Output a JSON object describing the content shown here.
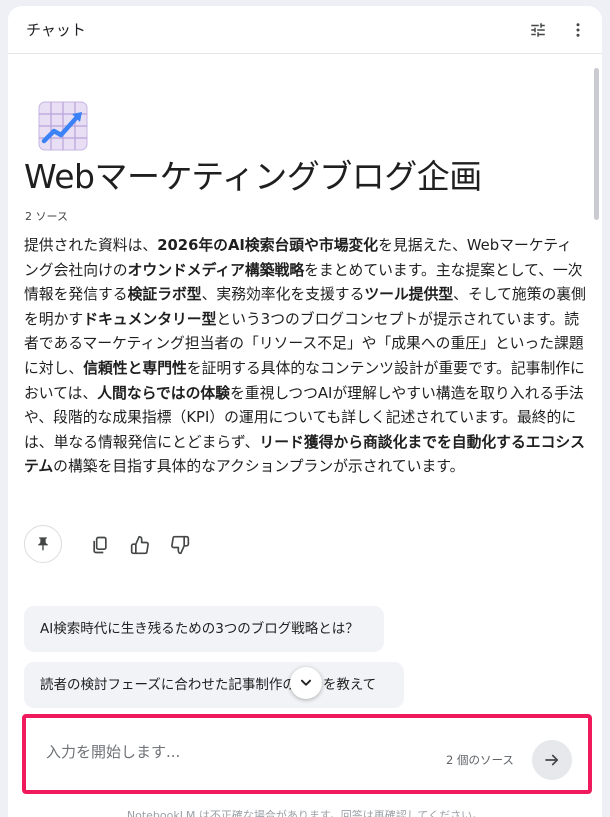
{
  "header": {
    "title": "チャット"
  },
  "notebook": {
    "title": "Webマーケティングブログ企画",
    "sources_label": "2 ソース",
    "summary": [
      {
        "text": "提供された資料は、",
        "bold": false
      },
      {
        "text": "2026年のAI検索台頭や市場変化",
        "bold": true
      },
      {
        "text": "を見据えた、Webマーケティング会社向けの",
        "bold": false
      },
      {
        "text": "オウンドメディア構築戦略",
        "bold": true
      },
      {
        "text": "をまとめています。主な提案として、一次情報を発信する",
        "bold": false
      },
      {
        "text": "検証ラボ型",
        "bold": true
      },
      {
        "text": "、実務効率化を支援する",
        "bold": false
      },
      {
        "text": "ツール提供型",
        "bold": true
      },
      {
        "text": "、そして施策の裏側を明かす",
        "bold": false
      },
      {
        "text": "ドキュメンタリー型",
        "bold": true
      },
      {
        "text": "という3つのブログコンセプトが提示されています。読者であるマーケティング担当者の「リソース不足」や「成果への重圧」といった課題に対し、",
        "bold": false
      },
      {
        "text": "信頼性と専門性",
        "bold": true
      },
      {
        "text": "を証明する具体的なコンテンツ設計が重要です。記事制作においては、",
        "bold": false
      },
      {
        "text": "人間ならではの体験",
        "bold": true
      },
      {
        "text": "を重視しつつAIが理解しやすい構造を取り入れる手法や、段階的な成果指標（KPI）の運用についても詳しく記述されています。最終的には、単なる情報発信にとどまらず、",
        "bold": false
      },
      {
        "text": "リード獲得から商談化までを自動化するエコシステム",
        "bold": true
      },
      {
        "text": "の構築を目指す具体的なアクションプランが示されています。",
        "bold": false
      }
    ]
  },
  "suggestions": [
    "AI検索時代に生き残るための3つのブログ戦略とは？",
    "読者の検討フェーズに合わせた記事制作のコツを教えて"
  ],
  "composer": {
    "placeholder": "入力を開始します...",
    "sources_label": "2 個のソース"
  },
  "footer_note": "NotebookLM は不正確な場合があります。回答は再確認してください。",
  "icons": {
    "notebook_emoji": "chart-increasing-icon",
    "tune": "tune-icon",
    "more": "more-vert-icon",
    "pin": "pin-icon",
    "copy": "copy-icon",
    "like": "thumb-up-icon",
    "dislike": "thumb-down-icon",
    "scroll_down": "chevron-down-icon",
    "send": "arrow-right-icon"
  },
  "colors": {
    "highlight_border": "#f0195c",
    "accent_line": "#3b82f6"
  }
}
